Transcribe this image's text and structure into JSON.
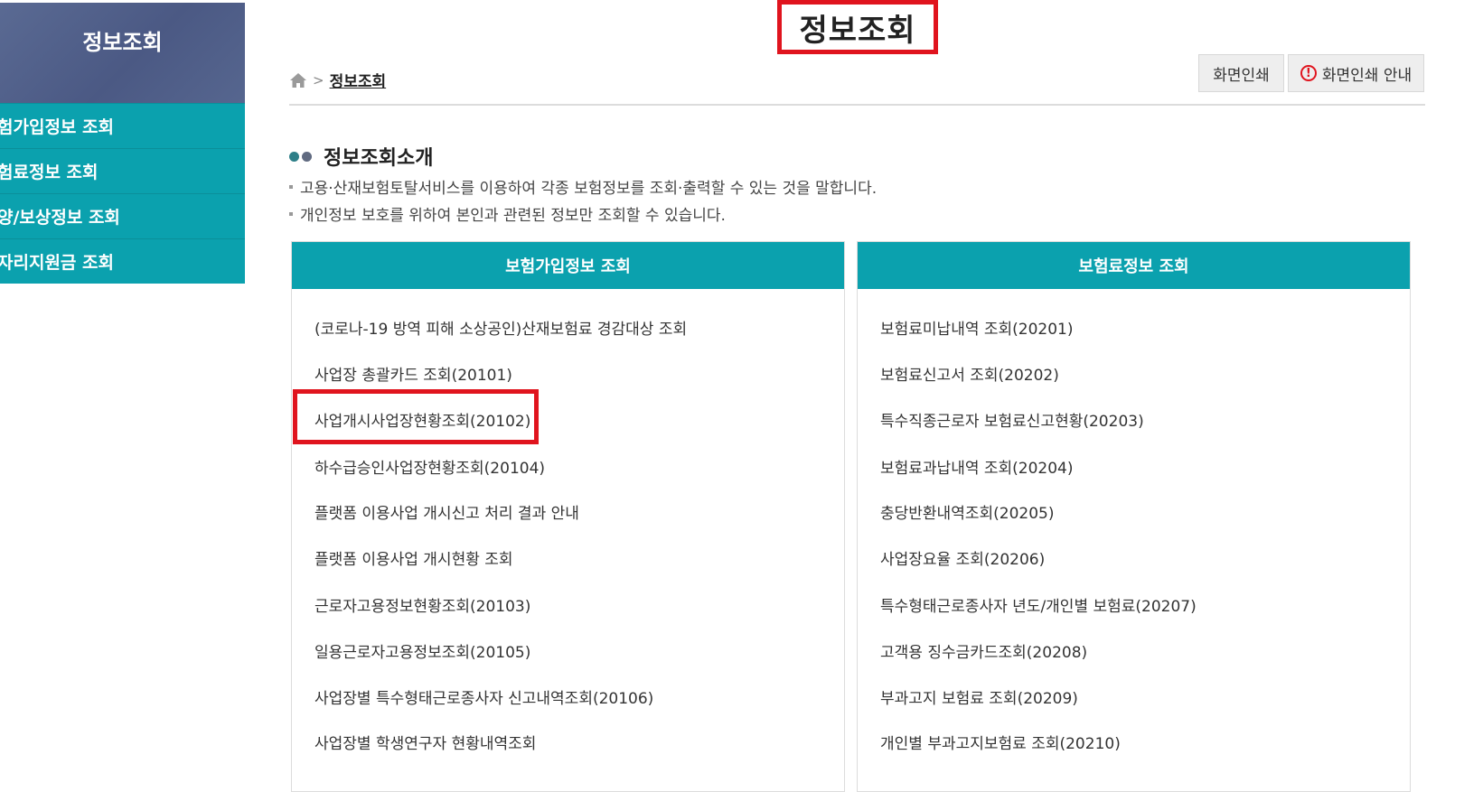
{
  "sidebar": {
    "title": "정보조회",
    "items": [
      {
        "label": "험가입정보 조회"
      },
      {
        "label": "험료정보 조회"
      },
      {
        "label": "양/보상정보 조회"
      },
      {
        "label": "자리지원금 조회"
      }
    ]
  },
  "page": {
    "title": "정보조회"
  },
  "breadcrumb": {
    "current": "정보조회"
  },
  "toolbar": {
    "print_label": "화면인쇄",
    "print_guide_label": "화면인쇄 안내"
  },
  "intro": {
    "title": "정보조회소개",
    "lines": [
      "고용·산재보험토탈서비스를 이용하여 각종 보험정보를 조회·출력할 수 있는 것을 말합니다.",
      "개인정보 보호를 위하여 본인과 관련된 정보만 조회할 수 있습니다."
    ]
  },
  "panels": {
    "left": {
      "header": "보험가입정보 조회",
      "items": [
        "(코로나-19 방역 피해 소상공인)산재보험료 경감대상 조회",
        "사업장 총괄카드 조회(20101)",
        "사업개시사업장현황조회(20102)",
        "하수급승인사업장현황조회(20104)",
        "플랫폼 이용사업 개시신고 처리 결과 안내",
        "플랫폼 이용사업 개시현황 조회",
        "근로자고용정보현황조회(20103)",
        "일용근로자고용정보조회(20105)",
        "사업장별 특수형태근로종사자 신고내역조회(20106)",
        "사업장별 학생연구자 현황내역조회"
      ]
    },
    "right": {
      "header": "보험료정보 조회",
      "items": [
        "보험료미납내역 조회(20201)",
        "보험료신고서 조회(20202)",
        "특수직종근로자 보험료신고현황(20203)",
        "보험료과납내역 조회(20204)",
        "충당반환내역조회(20205)",
        "사업장요율 조회(20206)",
        "특수형태근로종사자 년도/개인별 보험료(20207)",
        "고객용 징수금카드조회(20208)",
        "부과고지 보험료 조회(20209)",
        "개인별 부과고지보험료 조회(20210)"
      ]
    }
  },
  "colors": {
    "accent": "#0ba1ae",
    "highlight": "#e0141e",
    "sidebar_header": "#4b5984"
  }
}
